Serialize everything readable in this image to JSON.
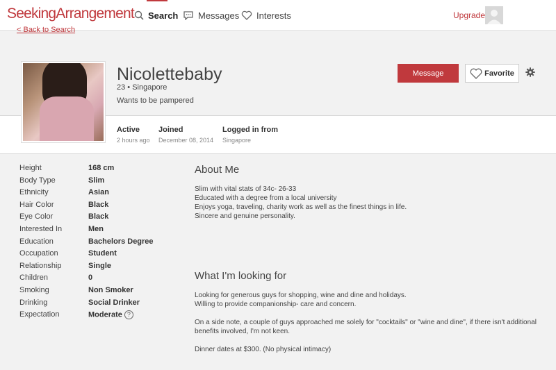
{
  "header": {
    "logo": "SeekingArrangement",
    "nav": [
      {
        "label": "Search",
        "icon": "search-icon"
      },
      {
        "label": "Messages",
        "icon": "messages-icon"
      },
      {
        "label": "Interests",
        "icon": "heart-icon"
      }
    ],
    "upgrade_label": "Upgrade"
  },
  "back_link": "< Back to Search",
  "profile": {
    "name": "Nicolettebaby",
    "age_location": "23 • Singapore",
    "tagline": "Wants to be pampered",
    "message_button": "Message",
    "favorite_button": "Favorite",
    "stats": [
      {
        "label": "Active",
        "value": "2 hours ago"
      },
      {
        "label": "Joined",
        "value": "December 08, 2014"
      },
      {
        "label": "Logged in from",
        "value": "Singapore"
      }
    ]
  },
  "details": [
    {
      "key": "Height",
      "value": "168 cm"
    },
    {
      "key": "Body Type",
      "value": "Slim"
    },
    {
      "key": "Ethnicity",
      "value": "Asian"
    },
    {
      "key": "Hair Color",
      "value": "Black"
    },
    {
      "key": "Eye Color",
      "value": "Black"
    },
    {
      "key": "Interested In",
      "value": "Men"
    },
    {
      "key": "Education",
      "value": "Bachelors Degree"
    },
    {
      "key": "Occupation",
      "value": "Student"
    },
    {
      "key": "Relationship",
      "value": "Single"
    },
    {
      "key": "Children",
      "value": "0"
    },
    {
      "key": "Smoking",
      "value": "Non Smoker"
    },
    {
      "key": "Drinking",
      "value": "Social Drinker"
    },
    {
      "key": "Expectation",
      "value": "Moderate"
    }
  ],
  "expectation_help": "?",
  "about": {
    "title": "About Me",
    "lines": [
      "Slim with vital stats of 34c- 26-33",
      "Educated with a degree from a local university",
      "Enjoys yoga, traveling, charity work as well as the finest things in life.",
      "Sincere and genuine personality."
    ]
  },
  "looking": {
    "title": "What I'm looking for",
    "p1_lines": [
      "Looking for generous guys for shopping, wine and dine and holidays.",
      "Willing to provide companionship- care and concern."
    ],
    "p2": "On a side note, a couple of guys approached me solely for \"cocktails\" or \"wine and dine\", if there isn't additional benefits involved, I'm not keen.",
    "p3": "Dinner dates at $300. (No physical intimacy)"
  },
  "colors": {
    "accent": "#c0393d",
    "background": "#f2f2f2"
  }
}
